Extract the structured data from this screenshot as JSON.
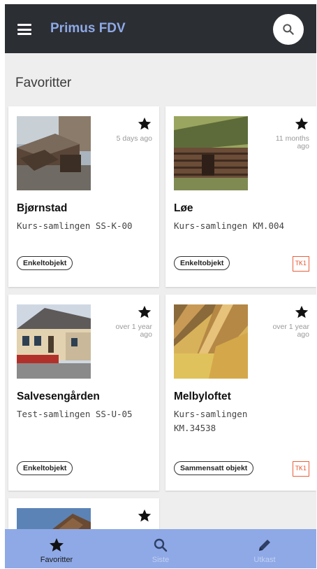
{
  "app": {
    "title": "Primus FDV"
  },
  "section": {
    "title": "Favoritter"
  },
  "cards": [
    {
      "name": "Bjørnstad",
      "time": "5 days ago",
      "code": "Kurs-samlingen  SS-K-00",
      "type": "Enkeltobjekt",
      "badge": ""
    },
    {
      "name": "Løe",
      "time": "11 months ago",
      "code": "Kurs-samlingen  KM.004",
      "type": "Enkeltobjekt",
      "badge": "TK1"
    },
    {
      "name": "Salvesengården",
      "time": "over 1 year ago",
      "code": "Test-samlingen  SS-U-05",
      "type": "Enkeltobjekt",
      "badge": ""
    },
    {
      "name": "Melbyloftet",
      "time": "over 1 year ago",
      "code": "Kurs-samlingen  KM.34538",
      "type": "Sammensatt objekt",
      "badge": "TK1"
    }
  ],
  "nav": [
    {
      "label": "Favoritter",
      "icon": "star-icon",
      "active": true
    },
    {
      "label": "Siste",
      "icon": "search-icon",
      "active": false
    },
    {
      "label": "Utkast",
      "icon": "pencil-icon",
      "active": false
    }
  ],
  "colors": {
    "appbar": "#2b2e33",
    "accent": "#8ea9e6",
    "badge": "#e8603c",
    "background": "#eeeeee"
  }
}
